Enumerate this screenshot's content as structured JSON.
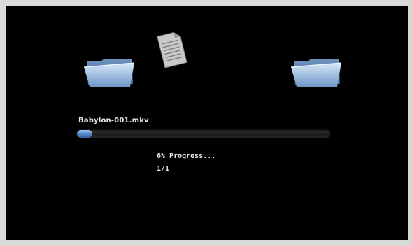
{
  "icons": {
    "source": "folder-icon",
    "file": "document-icon",
    "destination": "folder-icon"
  },
  "transfer": {
    "file_name": "Babylon-001.mkv",
    "progress_percent": 6,
    "progress_label": "6% Progress...",
    "count": "1/1"
  },
  "colors": {
    "background": "#000000",
    "text": "#e6e6e6",
    "progress_fill": "#4f86c7",
    "progress_track": "#262626",
    "folder": "#8fb3d9"
  }
}
